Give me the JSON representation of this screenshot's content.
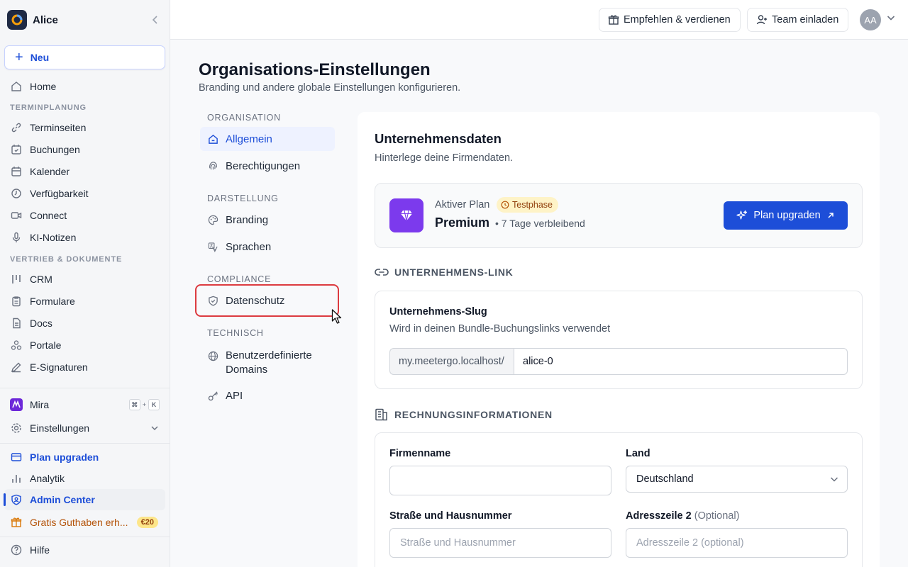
{
  "sidebar": {
    "org_name": "Alice",
    "new_label": "Neu",
    "home": "Home",
    "sections": {
      "terminplanung": "TERMINPLANUNG",
      "vertrieb": "VERTRIEB & DOKUMENTE"
    },
    "terminplanung_items": [
      "Terminseiten",
      "Buchungen",
      "Kalender",
      "Verfügbarkeit",
      "Connect",
      "KI-Notizen"
    ],
    "vertrieb_items": [
      "CRM",
      "Formulare",
      "Docs",
      "Portale",
      "E-Signaturen"
    ],
    "mira": "Mira",
    "mira_shortcut": [
      "⌘",
      "+",
      "K"
    ],
    "einstellungen": "Einstellungen",
    "plan_upgraden": "Plan upgraden",
    "analytik": "Analytik",
    "admin_center": "Admin Center",
    "gratis": "Gratis Guthaben erh...",
    "gratis_badge": "€20",
    "hilfe": "Hilfe"
  },
  "topbar": {
    "refer": "Empfehlen & verdienen",
    "invite": "Team einladen",
    "avatar": "AA"
  },
  "page": {
    "title": "Organisations-Einstellungen",
    "subtitle": "Branding und andere globale Einstellungen konfigurieren."
  },
  "subnav": {
    "sec_org": "ORGANISATION",
    "allgemein": "Allgemein",
    "berechtigungen": "Berechtigungen",
    "sec_darst": "DARSTELLUNG",
    "branding": "Branding",
    "sprachen": "Sprachen",
    "sec_compliance": "COMPLIANCE",
    "datenschutz": "Datenschutz",
    "sec_tech": "TECHNISCH",
    "domains_1": "Benutzerdefinierte",
    "domains_2": "Domains",
    "api": "API"
  },
  "content": {
    "title": "Unternehmensdaten",
    "subtitle": "Hinterlege deine Firmendaten.",
    "plan": {
      "label": "Aktiver Plan",
      "badge": "Testphase",
      "name": "Premium",
      "remaining": "• 7 Tage verbleibend",
      "upgrade": "Plan upgraden"
    },
    "link_section": "UNTERNEHMENS-LINK",
    "slug_label": "Unternehmens-Slug",
    "slug_help": "Wird in deinen Bundle-Buchungslinks verwendet",
    "slug_prefix": "my.meetergo.localhost/",
    "slug_value": "alice-0",
    "billing_section": "RECHNUNGSINFORMATIONEN",
    "firmenname_label": "Firmenname",
    "firmenname_value": "",
    "land_label": "Land",
    "land_value": "Deutschland",
    "strasse_label": "Straße und Hausnummer",
    "strasse_placeholder": "Straße und Hausnummer",
    "adresse2_label": "Adresszeile 2",
    "adresse2_optional": "(Optional)",
    "adresse2_placeholder": "Adresszeile 2 (optional)"
  },
  "colors": {
    "accent": "#1d4ed8",
    "highlight": "#dc3b40",
    "plan_icon": "#7c3aed",
    "badge_bg": "#fef3c7"
  }
}
